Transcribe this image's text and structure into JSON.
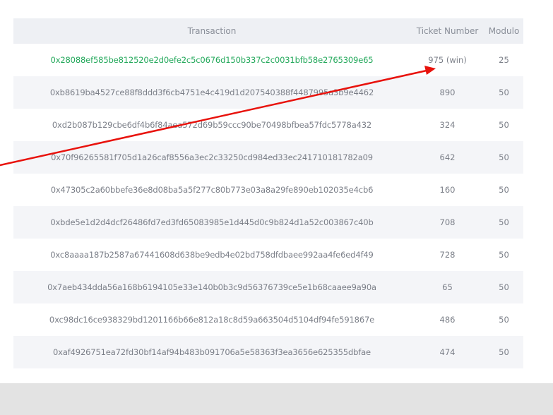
{
  "table": {
    "headers": {
      "transaction": "Transaction",
      "ticket": "Ticket Number",
      "modulo": "Modulo"
    },
    "rows": [
      {
        "tx": "0x28088ef585be812520e2d0efe2c5c0676d150b337c2c0031bfb58e2765309e65",
        "ticket": "975 (win)",
        "modulo": "25"
      },
      {
        "tx": "0xb8619ba4527ce88f8ddd3f6cb4751e4c419d1d207540388f4487995a3b9e4462",
        "ticket": "890",
        "modulo": "50"
      },
      {
        "tx": "0xd2b087b129cbe6df4b6f84aea572d69b59ccc90be70498bfbea57fdc5778a432",
        "ticket": "324",
        "modulo": "50"
      },
      {
        "tx": "0x70f96265581f705d1a26caf8556a3ec2c33250cd984ed33ec241710181782a09",
        "ticket": "642",
        "modulo": "50"
      },
      {
        "tx": "0x47305c2a60bbefe36e8d08ba5a5f277c80b773e03a8a29fe890eb102035e4cb6",
        "ticket": "160",
        "modulo": "50"
      },
      {
        "tx": "0xbde5e1d2d4dcf26486fd7ed3fd65083985e1d445d0c9b824d1a52c003867c40b",
        "ticket": "708",
        "modulo": "50"
      },
      {
        "tx": "0xc8aaaa187b2587a67441608d638be9edb4e02bd758dfdbaee992aa4fe6ed4f49",
        "ticket": "728",
        "modulo": "50"
      },
      {
        "tx": "0x7aeb434dda56a168b6194105e33e140b0b3c9d56376739ce5e1b68caaee9a90a",
        "ticket": "65",
        "modulo": "50"
      },
      {
        "tx": "0xc98dc16ce938329bd1201166b66e812a18c8d59a663504d5104df94fe591867e",
        "ticket": "486",
        "modulo": "50"
      },
      {
        "tx": "0xaf4926751ea72fd30bf14af94b483b091706a5e58363f3ea3656e625355dbfae",
        "ticket": "474",
        "modulo": "50"
      }
    ]
  },
  "colors": {
    "win_text": "#22a85a",
    "annotation_arrow": "#e8120c"
  }
}
